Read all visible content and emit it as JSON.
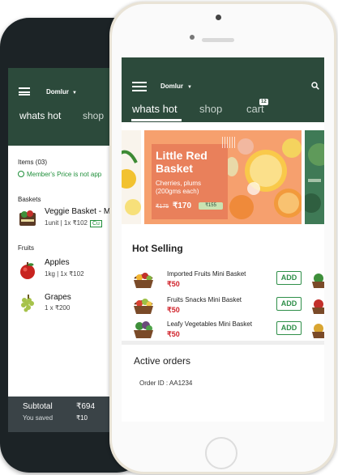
{
  "back_screen": {
    "location": "Domlur",
    "tabs": [
      "whats hot",
      "shop"
    ],
    "items_count": "Items (03)",
    "member_notice": "Member's Price is not app",
    "sections": {
      "baskets": "Baskets",
      "fruits": "Fruits"
    },
    "items": [
      {
        "name": "Veggie Basket - M",
        "meta": "1unit | 1x ₹102",
        "tag": "Cu"
      },
      {
        "name": "Apples",
        "meta": "1kg | 1x ₹102"
      },
      {
        "name": "Grapes",
        "meta": "1 x ₹200"
      }
    ],
    "footer": {
      "subtotal_label": "Subtotal",
      "subtotal_value": "₹694",
      "saved_label": "You saved",
      "saved_value": "₹10"
    }
  },
  "front_screen": {
    "location": "Domlur",
    "tabs": {
      "whats_hot": "whats hot",
      "shop": "shop",
      "cart": "cart"
    },
    "cart_badge": "12",
    "promo": {
      "title": "Little Red Basket",
      "subtitle": "Cherries, plums (200gms each)",
      "old_price": "₹175",
      "new_price": "₹170",
      "tag": "₹155"
    },
    "hot_selling": {
      "title": "Hot Selling",
      "add_label": "ADD",
      "items": [
        {
          "name": "Imported Fruits Mini Basket",
          "price": "₹50"
        },
        {
          "name": "Fruits Snacks Mini Basket",
          "price": "₹50"
        },
        {
          "name": "Leafy Vegetables Mini Basket",
          "price": "₹50"
        }
      ]
    },
    "active_orders": {
      "title": "Active orders",
      "order_id": "Order ID : AA1234"
    }
  },
  "colors": {
    "brand_green": "#2c4a3b",
    "price_red": "#d0232b",
    "add_green": "#2f8f49",
    "promo_orange": "#e9805b"
  }
}
